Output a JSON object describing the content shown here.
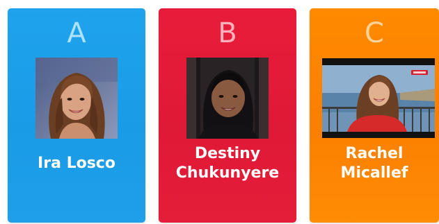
{
  "cards": [
    {
      "letter": "A",
      "name_lines": [
        "Ira Losco"
      ],
      "color": "#1fa3ec"
    },
    {
      "letter": "B",
      "name_lines": [
        "Destiny",
        "Chukunyere"
      ],
      "color": "#e81c3a"
    },
    {
      "letter": "C",
      "name_lines": [
        "Rachel",
        "Micallef"
      ],
      "color": "#ff8a00"
    }
  ]
}
